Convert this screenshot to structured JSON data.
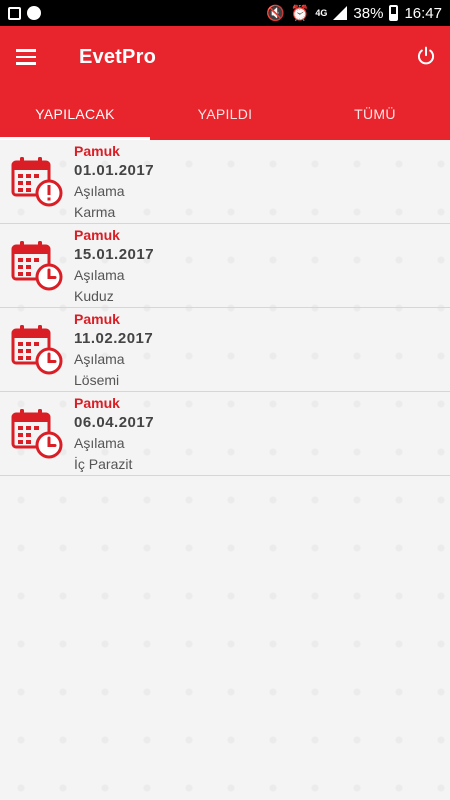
{
  "status_bar": {
    "battery": "38%",
    "time": "16:47",
    "network": "4G"
  },
  "app_bar": {
    "title": "EvetPro"
  },
  "tabs": [
    {
      "label": "YAPILACAK",
      "active": true
    },
    {
      "label": "YAPILDI",
      "active": false
    },
    {
      "label": "TÜMÜ",
      "active": false
    }
  ],
  "items": [
    {
      "name": "Pamuk",
      "date": "01.01.2017",
      "type": "Aşılama",
      "description": "Karma",
      "icon": "calendar-alert-icon"
    },
    {
      "name": "Pamuk",
      "date": "15.01.2017",
      "type": "Aşılama",
      "description": "Kuduz",
      "icon": "calendar-clock-icon"
    },
    {
      "name": "Pamuk",
      "date": "11.02.2017",
      "type": "Aşılama",
      "description": "Lösemi",
      "icon": "calendar-clock-icon"
    },
    {
      "name": "Pamuk",
      "date": "06.04.2017",
      "type": "Aşılama",
      "description": "İç Parazit",
      "icon": "calendar-clock-icon"
    }
  ],
  "colors": {
    "primary": "#e8242c",
    "name_text": "#d91e26"
  }
}
